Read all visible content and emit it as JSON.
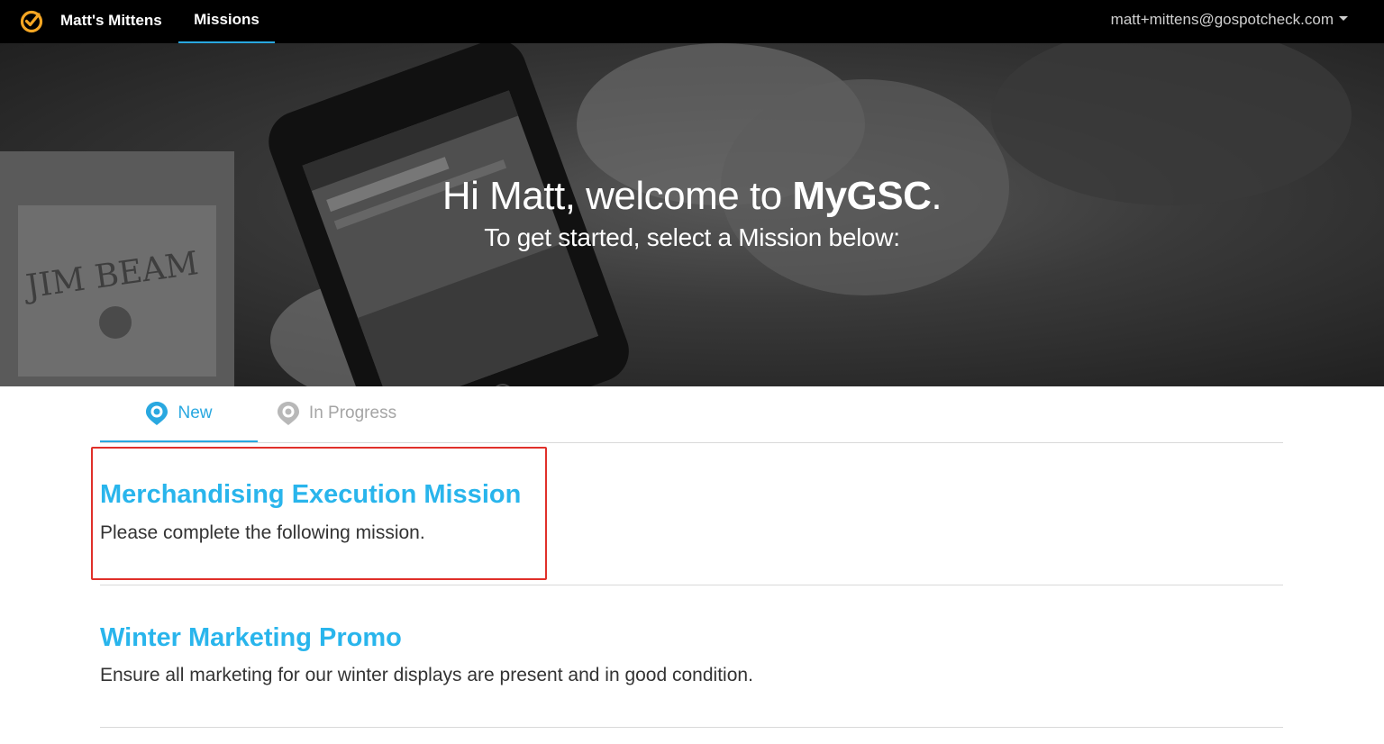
{
  "nav": {
    "brand": "Matt's Mittens",
    "missions_label": "Missions",
    "user_email": "matt+mittens@gospotcheck.com",
    "accent_color": "#f5a623"
  },
  "hero": {
    "greeting": "Hi Matt, welcome to ",
    "app_name": "MyGSC",
    "punct": ".",
    "subtitle": "To get started, select a Mission below:"
  },
  "tabs": [
    {
      "label": "New",
      "active": true,
      "icon": "location-pin-icon"
    },
    {
      "label": "In Progress",
      "active": false,
      "icon": "location-pin-icon"
    }
  ],
  "missions": [
    {
      "title": "Merchandising Execution Mission",
      "description": "Please complete the following mission."
    },
    {
      "title": "Winter Marketing Promo",
      "description": "Ensure all marketing for our winter displays are present and in good condition."
    }
  ],
  "colors": {
    "link": "#29b5ec",
    "tab_active": "#29a8e0",
    "highlight": "#e0302a"
  }
}
